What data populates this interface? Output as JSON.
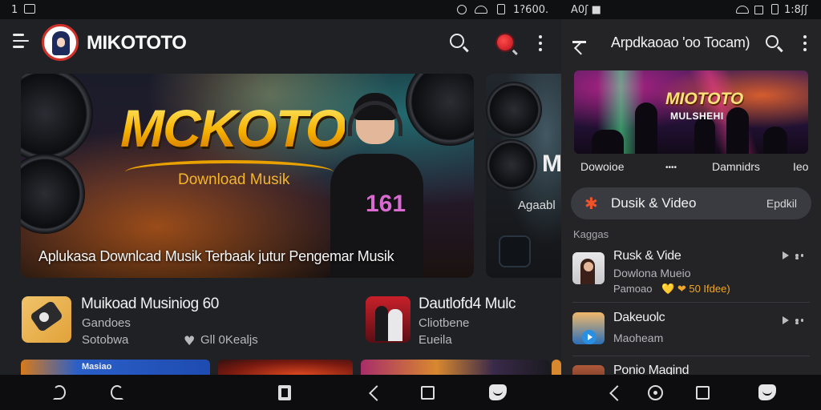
{
  "status_bar": {
    "left_text": "1",
    "mid_time": "1?600.",
    "right_left_text": "A0ʃ ■",
    "right_time": "1:8ʃʃ"
  },
  "left_app": {
    "brand": "MIKOTOTO",
    "hero": {
      "title": "MCKOTO",
      "subtitle": "Download Musik",
      "shirt_text": "161",
      "caption": "Aplukasa Downlcad Musik Terbaak jutur Pengemar Musik"
    },
    "hero2": {
      "big_letter": "M",
      "text": "Agaabl"
    },
    "apps": [
      {
        "title": "Muikoad Musiniog 60",
        "line1": "Gandoes",
        "line2": "Sotobwa",
        "rating": "Gll 0Kealjs"
      },
      {
        "title": "Dautlofd4 Mulc",
        "line1": "Cliotbene",
        "line2": "Eueila"
      }
    ],
    "tile_label": "Masiao"
  },
  "right_app": {
    "title": "Arpdkaoao 'oo Tocam)",
    "banner": {
      "title": "MIOTOTO",
      "subtitle": "MULSHEHI"
    },
    "tabs": [
      "Dowoioe",
      "••••",
      "Damnidrs",
      "Ieo"
    ],
    "chip": {
      "label": "Dusik & Video",
      "right": "Epdkil"
    },
    "section_label": "Kaggas",
    "items": [
      {
        "title": "Rusk & Vide",
        "sub": "Dowlona Mueio",
        "meta_left": "Pamoao",
        "meta_accent": "💛 ❤ 50 Ifdee)"
      },
      {
        "title": "Dakeuolc",
        "sub": "Maoheam"
      },
      {
        "title": "Ponio Magind"
      }
    ]
  },
  "colors": {
    "accent_red": "#d0322a",
    "accent_gold": "#f6b100",
    "chip_bg": "#3a3b40",
    "star": "#f0532a"
  }
}
